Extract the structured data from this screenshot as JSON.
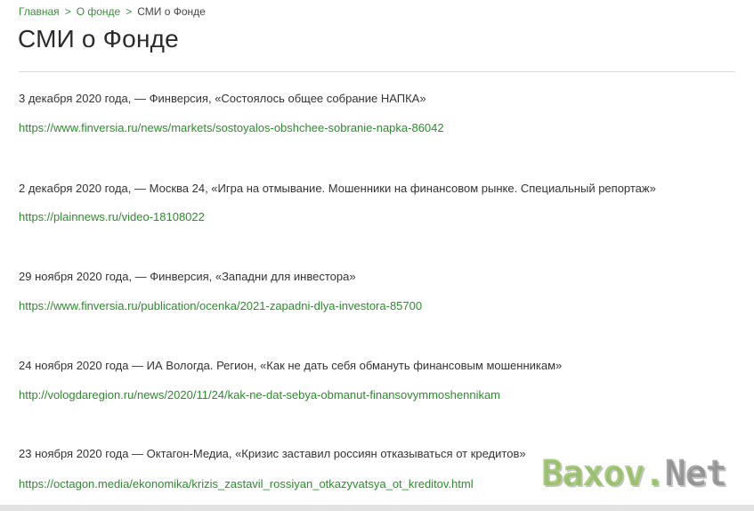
{
  "breadcrumb": {
    "items": [
      {
        "label": "Главная"
      },
      {
        "label": "О фонде"
      }
    ],
    "separator": ">",
    "current": "СМИ о Фонде"
  },
  "page": {
    "title": "СМИ о Фонде"
  },
  "entries": [
    {
      "text": "3 декабря 2020 года, — Финверсия, «Состоялось общее собрание НАПКА»",
      "link": "https://www.finversia.ru/news/markets/sostoyalos-obshchee-sobranie-napka-86042"
    },
    {
      "text": "2 декабря 2020 года, — Москва 24, «Игра на отмывание. Мошенники на финансовом рынке. Специальный репортаж»",
      "link": "https://plainnews.ru/video-18108022"
    },
    {
      "text": "29 ноября 2020 года, — Финверсия, «Западни для инвестора»",
      "link": "https://www.finversia.ru/publication/ocenka/2021-zapadni-dlya-investora-85700"
    },
    {
      "text": "24 ноября 2020 года — ИА Вологда. Регион, «Как не дать себя обмануть финансовым мошенникам»",
      "link": "http://vologdaregion.ru/news/2020/11/24/kak-ne-dat-sebya-obmanut-finansovymmoshennikam"
    },
    {
      "text": "23 ноября 2020 года — Октагон-Медиа, «Кризис заставил россиян отказываться от кредитов»",
      "link": "https://octagon.media/ekonomika/krizis_zastavil_rossiyan_otkazyvatsya_ot_kreditov.html"
    }
  ],
  "watermark": {
    "part1": "Baxov.",
    "part2": "Net"
  },
  "colors": {
    "link": "#2e8b2e",
    "breadcrumb_link": "#3a8f3a",
    "text": "#333333"
  }
}
